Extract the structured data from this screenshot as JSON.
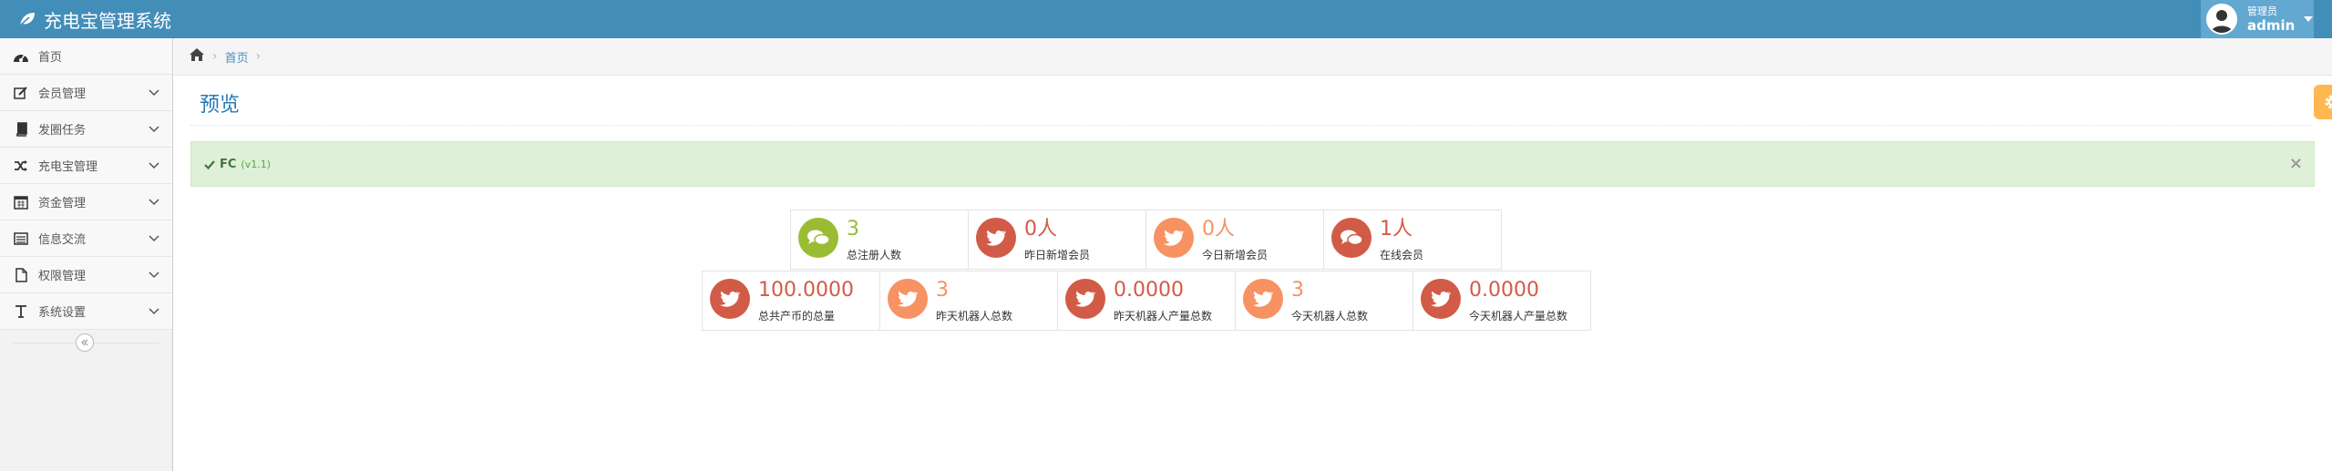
{
  "app": {
    "title": "充电宝管理系统"
  },
  "user": {
    "role": "管理员",
    "name": "admin"
  },
  "sidebar": {
    "items": [
      {
        "label": "首页",
        "icon": "dashboard-icon"
      },
      {
        "label": "会员管理",
        "icon": "edit-icon"
      },
      {
        "label": "发圈任务",
        "icon": "book-icon"
      },
      {
        "label": "充电宝管理",
        "icon": "shuffle-icon"
      },
      {
        "label": "资金管理",
        "icon": "calendar-icon"
      },
      {
        "label": "信息交流",
        "icon": "list-icon"
      },
      {
        "label": "权限管理",
        "icon": "file-icon"
      },
      {
        "label": "系统设置",
        "icon": "text-icon"
      }
    ]
  },
  "breadcrumb": {
    "home": "首页"
  },
  "page": {
    "title": "预览"
  },
  "alert": {
    "text": "FC",
    "version": "(v1.1)"
  },
  "stats": [
    {
      "value": "3",
      "label": "总注册人数",
      "icon": "comments-icon",
      "color": "#9abc32"
    },
    {
      "value": "0人",
      "label": "昨日新增会员",
      "icon": "twitter-icon",
      "color": "#d15b47"
    },
    {
      "value": "0人",
      "label": "今日新增会员",
      "icon": "twitter-icon",
      "color": "#f79263"
    },
    {
      "value": "1人",
      "label": "在线会员",
      "icon": "comments-icon",
      "color": "#d15b47"
    },
    {
      "value": "100.0000",
      "label": "总共产币的总量",
      "icon": "twitter-icon",
      "color": "#d15b47"
    },
    {
      "value": "3",
      "label": "昨天机器人总数",
      "icon": "twitter-icon",
      "color": "#f79263"
    },
    {
      "value": "0.0000",
      "label": "昨天机器人产量总数",
      "icon": "twitter-icon",
      "color": "#d15b47"
    },
    {
      "value": "3",
      "label": "今天机器人总数",
      "icon": "twitter-icon",
      "color": "#f79263"
    },
    {
      "value": "0.0000",
      "label": "今天机器人产量总数",
      "icon": "twitter-icon",
      "color": "#d15b47"
    }
  ],
  "colors": {
    "navbar": "#438eb9",
    "accent": "#2679b5",
    "success_bg": "#dff0d8",
    "settings": "#ffb752"
  }
}
